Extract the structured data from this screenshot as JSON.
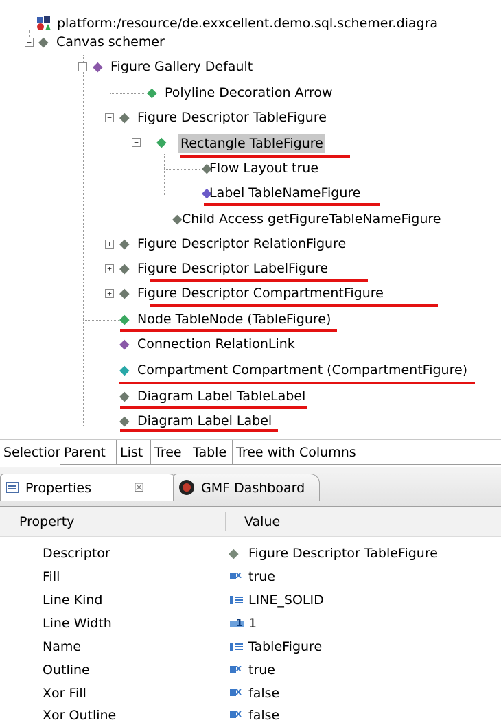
{
  "tree": {
    "root_label": "platform:/resource/de.exxcellent.demo.sql.schemer.diagra",
    "nodes": [
      {
        "label": "Canvas schemer"
      },
      {
        "label": "Figure Gallery Default"
      },
      {
        "label": "Polyline Decoration Arrow"
      },
      {
        "label": "Figure Descriptor TableFigure"
      },
      {
        "label": "Rectangle TableFigure"
      },
      {
        "label": "Flow Layout true"
      },
      {
        "label": "Label TableNameFigure"
      },
      {
        "label": "Child Access getFigureTableNameFigure"
      },
      {
        "label": "Figure Descriptor RelationFigure"
      },
      {
        "label": "Figure Descriptor LabelFigure"
      },
      {
        "label": "Figure Descriptor CompartmentFigure"
      },
      {
        "label": "Node TableNode (TableFigure)"
      },
      {
        "label": "Connection RelationLink"
      },
      {
        "label": "Compartment Compartment (CompartmentFigure)"
      },
      {
        "label": "Diagram Label TableLabel"
      },
      {
        "label": "Diagram Label Label"
      }
    ],
    "expand_glyph": "⊟",
    "collapse_glyph": "⊞",
    "node_icon_glyph": "◆",
    "colors": {
      "node_gray": "#6e7a6e",
      "node_green": "#3aa860",
      "node_purple": "#8a58a8",
      "node_violet": "#6a5ac8",
      "node_teal": "#28a8a8",
      "underline": "#e41111",
      "selection": "#c8c8c8"
    }
  },
  "selection_tabs": [
    "Selection",
    "Parent",
    "List",
    "Tree",
    "Table",
    "Tree with Columns"
  ],
  "view_tabs": {
    "properties_label": "Properties",
    "properties_close": "☒",
    "gmf_label": "GMF Dashboard"
  },
  "properties": {
    "col_property": "Property",
    "col_value": "Value",
    "rows": [
      {
        "name": "Descriptor",
        "value": "Figure Descriptor TableFigure",
        "icon": "figure-descriptor-icon"
      },
      {
        "name": "Fill",
        "value": "true",
        "icon": "boolean-icon"
      },
      {
        "name": "Line Kind",
        "value": "LINE_SOLID",
        "icon": "text-icon"
      },
      {
        "name": "Line Width",
        "value": "1",
        "icon": "number-icon"
      },
      {
        "name": "Name",
        "value": "TableFigure",
        "icon": "text-icon"
      },
      {
        "name": "Outline",
        "value": "true",
        "icon": "boolean-icon"
      },
      {
        "name": "Xor Fill",
        "value": "false",
        "icon": "boolean-icon"
      },
      {
        "name": "Xor Outline",
        "value": "false",
        "icon": "boolean-icon"
      }
    ]
  }
}
